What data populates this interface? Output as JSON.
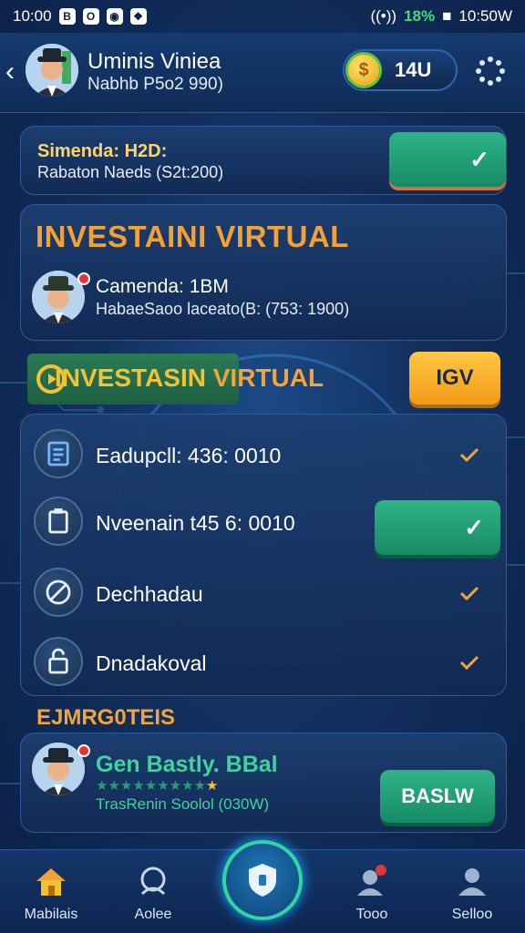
{
  "status_bar": {
    "time_left": "10:00",
    "battery": "18%",
    "time_right": "10:50W"
  },
  "header": {
    "name": "Uminis Viniea",
    "subtitle": "Nabhb P5o2 990)",
    "coins": "14U"
  },
  "summary_card": {
    "title": "Simenda: H2D:",
    "subtitle": "Rabaton Naeds (S2t:200)"
  },
  "investment_card": {
    "title": "INVESTAINI VIRTUAL",
    "user_name": "Camenda: 1BM",
    "user_detail": "HabaeSaoo laceato(B: (753: 1900)"
  },
  "section": {
    "title_main": "INVESTASIN",
    "title_tail": "VIRTUAL",
    "action_label": "IGV"
  },
  "list": {
    "items": [
      {
        "label": "Eadupcll: 436: 0010",
        "icon": "document-icon"
      },
      {
        "label": "Nveenain t45 6: 0010",
        "icon": "clipboard-icon"
      },
      {
        "label": "Dechhadau",
        "icon": "pen-icon"
      },
      {
        "label": "Dnadakoval",
        "icon": "lock-icon"
      }
    ]
  },
  "experts": {
    "title": "EJMRG0TEIS",
    "name": "Gen Bastly. BBal",
    "rating": "9 of 10",
    "detail": "TrasRenin Soolol (030W)",
    "button": "BASLW"
  },
  "bottom_nav": {
    "items": [
      {
        "label": "Mabilais",
        "icon": "home-icon",
        "active": true
      },
      {
        "label": "Aolee",
        "icon": "chat-icon"
      },
      {
        "label": "Tooo",
        "icon": "user-group-icon"
      },
      {
        "label": "Selloo",
        "icon": "profile-icon"
      }
    ]
  },
  "colors": {
    "background": "#122f5e",
    "accent_orange": "#f0a53c",
    "accent_green": "#2fb486",
    "accent_gold": "#f3c233"
  }
}
